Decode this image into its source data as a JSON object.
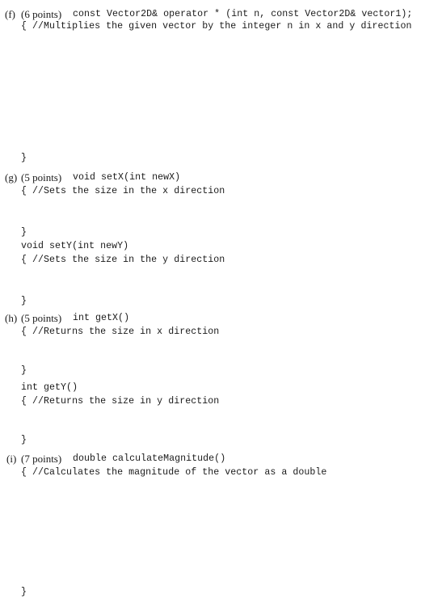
{
  "items": [
    {
      "label": "(f)",
      "points": "(6 points)",
      "signature": "const Vector2D& operator * (int n, const Vector2D& vector1);",
      "comment": "{ //Multiplies the given vector by the integer n in x and y direction",
      "close": "}"
    },
    {
      "label": "(g)",
      "points": "(5 points)",
      "signature": "void setX(int newX)",
      "comment": "{ //Sets the size in the x direction",
      "close": "}",
      "signature2": "void setY(int newY)",
      "comment2": "{ //Sets the size in the y direction",
      "close2": "}"
    },
    {
      "label": "(h)",
      "points": "(5 points)",
      "signature": "int getX()",
      "comment": "{ //Returns the size in x direction",
      "close": "}",
      "signature2": "int getY()",
      "comment2": "{ //Returns the size in y direction",
      "close2": "}"
    },
    {
      "label": "(i)",
      "points": "(7 points)",
      "signature": "double calculateMagnitude()",
      "comment": "{ //Calculates the magnitude of the vector as a double",
      "close": "}"
    }
  ]
}
